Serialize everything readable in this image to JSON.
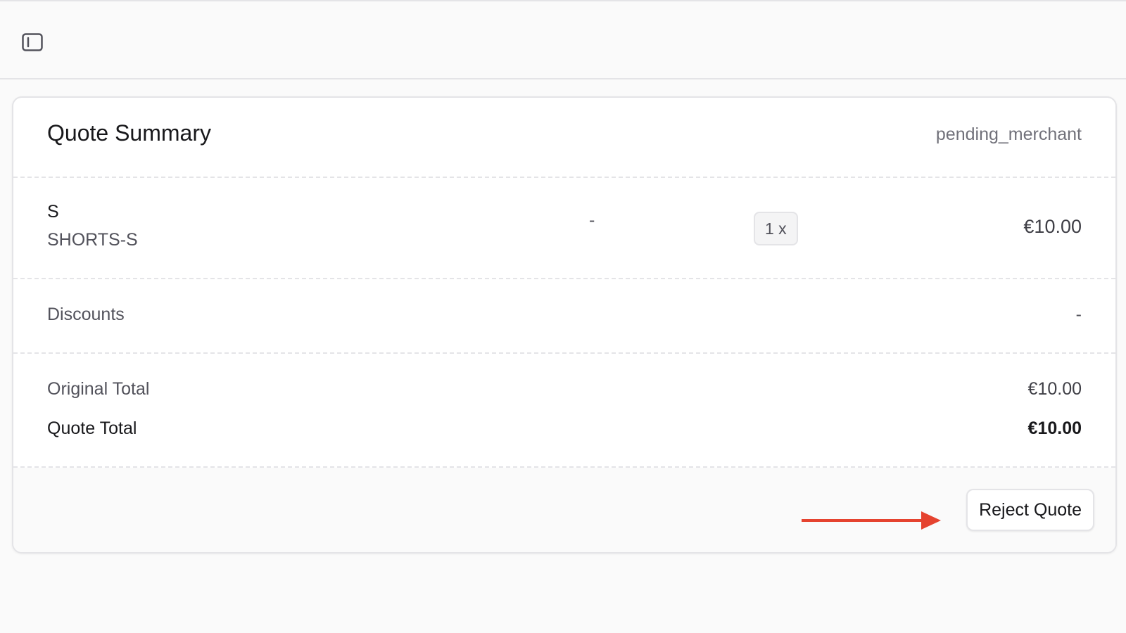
{
  "topbar": {
    "toggle_icon": "sidebar-toggle-icon"
  },
  "quote": {
    "title": "Quote Summary",
    "status": "pending_merchant",
    "item": {
      "name": "S",
      "sku": "SHORTS-S",
      "variant_value": "-",
      "quantity": "1 x",
      "price": "€10.00"
    },
    "discounts": {
      "label": "Discounts",
      "value": "-"
    },
    "totals": {
      "original_label": "Original Total",
      "original_value": "€10.00",
      "quote_label": "Quote Total",
      "quote_value": "€10.00"
    },
    "actions": {
      "reject_label": "Reject Quote"
    }
  },
  "colors": {
    "annotation_arrow": "#e5432f",
    "border": "#e4e4e7",
    "muted_text": "#52525b"
  }
}
